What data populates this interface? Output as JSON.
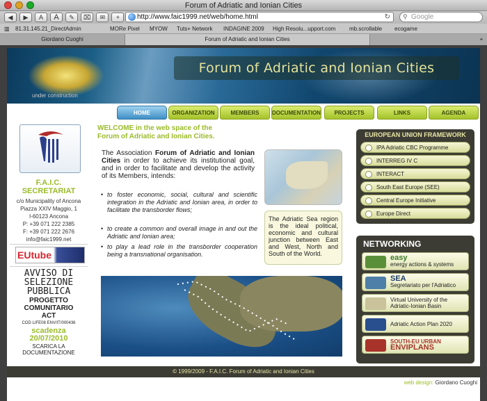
{
  "browser": {
    "title": "Forum of Adriatic and Ionian Cities",
    "url": "http://www.faic1999.net/web/home.html",
    "search_placeholder": "Google",
    "toolbar": {
      "back": "◀",
      "forward": "▶",
      "text_small": "A",
      "text_large": "A",
      "edit": "✎",
      "bookmark": "⌧",
      "mail": "✉",
      "add": "+"
    },
    "bookmarks": [
      "81.31.145.21_DirectAdmin",
      "MORe Pixel",
      "MYOW",
      "Tuts+ Network",
      "INDAGINE 2009",
      "High Resolu...upport.com",
      "mb.scrollable",
      "ecogame"
    ],
    "tabs": [
      "Giordano Cuoghi",
      "Forum of Adriatic and Ionian Cities"
    ],
    "new_tab": "+"
  },
  "banner": {
    "title": "Forum of Adriatic and Ionian Cities",
    "note": "under construction"
  },
  "nav": [
    "HOME",
    "ORGANIZATION",
    "MEMBERS",
    "DOCUMENTATION",
    "PROJECTS",
    "LINKS",
    "AGENDA"
  ],
  "secretariat": {
    "title_1": "F.A.I.C.",
    "title_2": "SECRETARIAT",
    "lines": [
      "c/o Municipality of Ancona",
      "Piazza XXIV Maggio, 1",
      "I-60123 Ancona",
      "P: +39 071 222 2385",
      "F: +39 071 222 2676",
      "info@faic1999.net"
    ],
    "eutube": "EUtube"
  },
  "notice": {
    "l1": "AVVISO DI",
    "l2": "SELEZIONE",
    "l3": "PUBBLICA",
    "l4": "PROGETTO",
    "l5": "COMUNITARIO",
    "l6": "ACT",
    "code": "COD LIFE08 ENV/IT/000436",
    "deadline_label": "scadenza",
    "deadline": "20/07/2010",
    "dl1": "SCARICA LA",
    "dl2": "DOCUMENTAZIONE"
  },
  "main": {
    "welcome_1": "WELCOME in the web space of the",
    "welcome_2": "Forum of Adriatic and Ionian Cities.",
    "intro_a": "The Association ",
    "intro_b": "Forum of Adriatic and Ionian Cities",
    "intro_c": " in order to achieve its institutional goal, and in order to facilitate and develop the activity of its Members, intends:",
    "bullets": [
      "to foster economic, social, cultural and scientific integration in the Adriatic and Ionian area, in order to facilitate the transborder flows;",
      "to create a common and overall image in and out the Adriatic and Ionian area;",
      "to play a lead role in the transborder cooperation being a transnational organisation."
    ],
    "sea_note": "The Adriatic Sea region is the ideal political, economic and cultural junction between East and West, North and South of the World."
  },
  "eu": {
    "title": "EUROPEAN UNION FRAMEWORK",
    "links": [
      "IPA Adriatic CBC Programme",
      "INTERREG IV C",
      "INTERACT",
      "South East Europe (SEE)",
      "Central Europe Initiative",
      "Europe Direct"
    ]
  },
  "networking": {
    "title": "NETWORKING",
    "links": [
      {
        "name": "easy",
        "sub": "energy actions & systems"
      },
      {
        "name": "SEA",
        "sub": "Segretariato per l'Adriatico"
      },
      {
        "name": "Virtual University of the",
        "sub": "Adriatic-Ionian Basin"
      },
      {
        "name": "Adriatic Action Plan 2020",
        "sub": ""
      },
      {
        "name": "SOUTH-EU URBAN",
        "sub": "ENVIPLANS"
      }
    ]
  },
  "footer": {
    "copyright": "© 1999/2009 - F.A.I.C. Forum of Adriatic and Ionian Cities",
    "design_label": "web design:",
    "design_name": " Giordano Cuoghi"
  },
  "colors": {
    "accent_green": "#9bbb2a",
    "dark_panel": "#3c3c34",
    "nav_home": "#3f8fc4"
  }
}
